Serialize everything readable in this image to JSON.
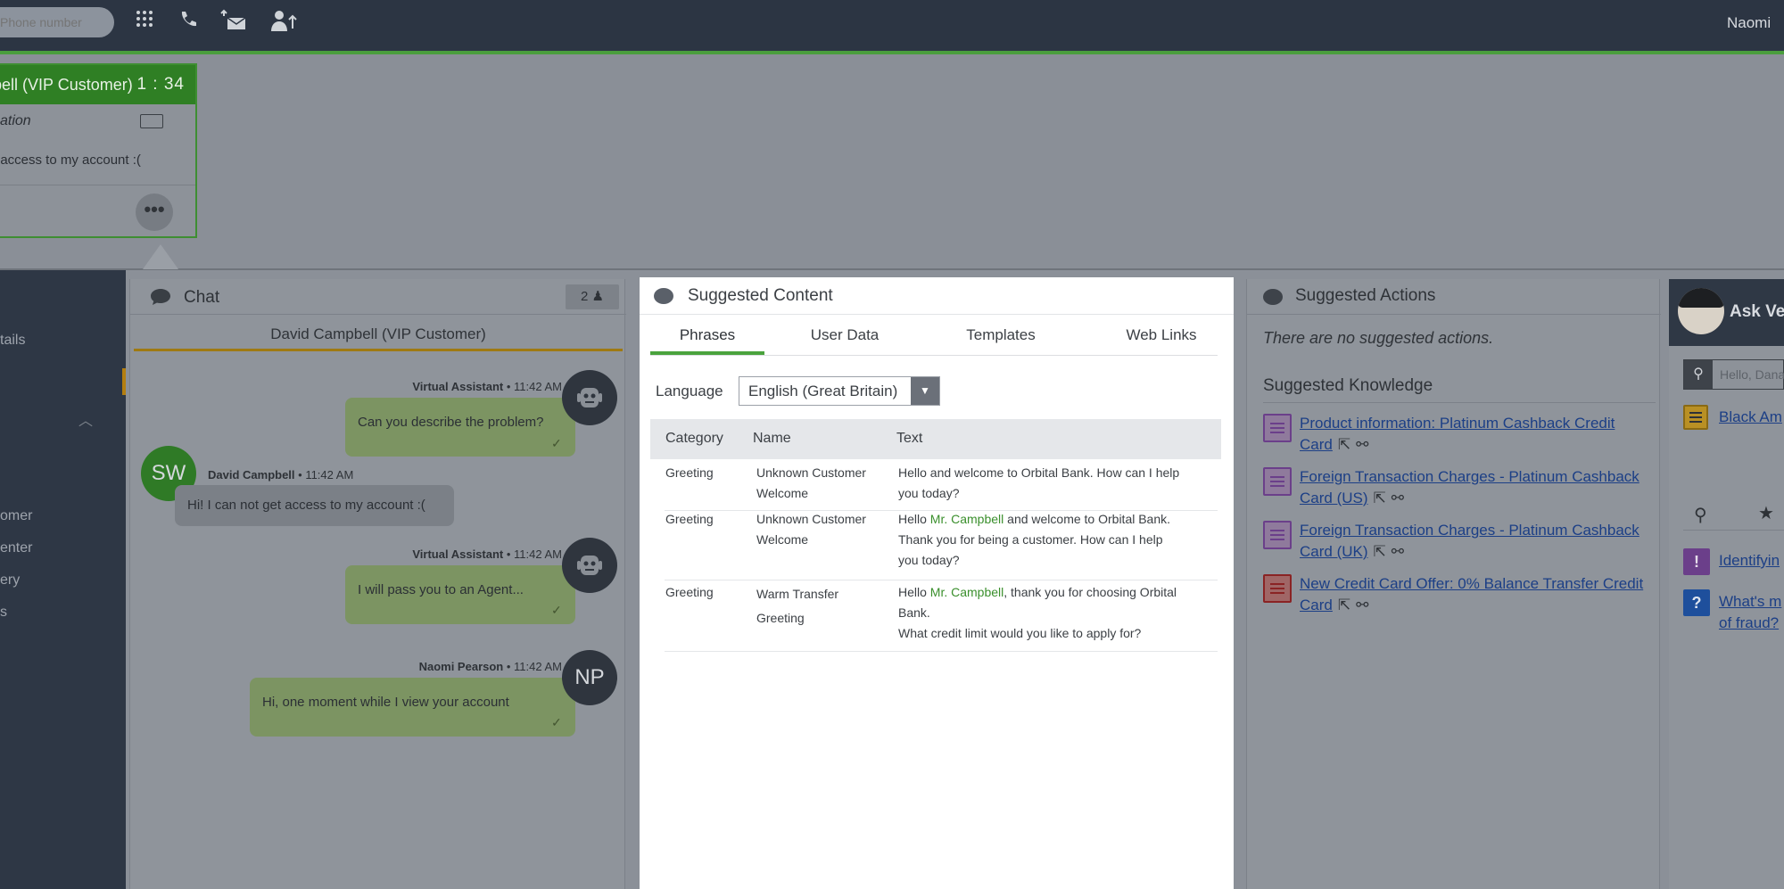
{
  "topbar": {
    "phone_placeholder": "Phone number",
    "icons": [
      "dialpad-icon",
      "phone-icon",
      "mail-transfer-icon",
      "agent-transfer-icon"
    ],
    "user_name": "Naomi"
  },
  "card": {
    "customer": "bell (VIP Customer)",
    "timer": "1 : 34",
    "sub": "cation",
    "message": "t access to my account :("
  },
  "nav": {
    "items": [
      "tails",
      "omer",
      "enter",
      "ery",
      "s"
    ]
  },
  "chat": {
    "title": "Chat",
    "count": "2",
    "customer": "David Campbell (VIP Customer)",
    "messages": [
      {
        "sender": "Virtual Assistant",
        "time": "11:42 AM",
        "text": "Can you describe the problem?"
      },
      {
        "sender": "David Campbell",
        "time": "11:42 AM",
        "text": "Hi! I can not get access to my account :(",
        "initials": "SW"
      },
      {
        "sender": "Virtual Assistant",
        "time": "11:42 AM",
        "text": "I will pass you to an Agent..."
      },
      {
        "sender": "Naomi Pearson",
        "time": "11:42 AM",
        "text": "Hi, one moment while I view your account",
        "initials": "NP"
      }
    ]
  },
  "suggested_content": {
    "title": "Suggested Content",
    "tabs": [
      "Phrases",
      "User Data",
      "Templates",
      "Web Links"
    ],
    "language_label": "Language",
    "language_value": "English (Great Britain)",
    "columns": [
      "Category",
      "Name",
      "Text"
    ],
    "rows": [
      {
        "category": "Greeting",
        "name_1": "Unknown Customer",
        "name_2": "Welcome",
        "text_1": "Hello and welcome to Orbital Bank. How can I help",
        "text_2": "you today?"
      },
      {
        "category": "Greeting",
        "name_1": "Unknown Customer",
        "name_2": "Welcome",
        "text_pre": "Hello ",
        "text_hl": "Mr. Campbell",
        "text_post": " and welcome to Orbital Bank.",
        "text_2": "Thank you for being a customer. How can I help",
        "text_3": "you today?"
      },
      {
        "category": "Greeting",
        "name_1": "Warm Transfer",
        "name_2": "Greeting",
        "text_pre": "Hello ",
        "text_hl": "Mr. Campbell",
        "text_post": ", thank you for choosing Orbital",
        "text_2": "Bank.",
        "text_3": "What credit limit would you like to apply for?"
      }
    ]
  },
  "suggested_actions": {
    "title": "Suggested Actions",
    "empty": "There are no suggested actions.",
    "knowledge_title": "Suggested Knowledge",
    "knowledge": [
      {
        "line1": "Product information: Platinum Cashback Credit",
        "line2": "Card",
        "color": "#6b3f8a"
      },
      {
        "line1": "Foreign Transaction Charges - Platinum Cashback",
        "line2": "Card (US)",
        "color": "#6b3f8a"
      },
      {
        "line1": "Foreign Transaction Charges - Platinum Cashback",
        "line2": "Card (UK)",
        "color": "#6b3f8a"
      },
      {
        "line1": "New Credit Card Offer: 0% Balance Transfer Credit",
        "line2": "Card",
        "color": "#8a2324"
      }
    ]
  },
  "ask": {
    "title": "Ask Ve",
    "search_placeholder": "Hello, Dana",
    "top_link": "Black Am",
    "links": [
      {
        "line1": "Identifyin",
        "line2": "",
        "badge": "!"
      },
      {
        "line1": "What's m",
        "line2": "of fraud?",
        "badge": "?"
      }
    ]
  }
}
